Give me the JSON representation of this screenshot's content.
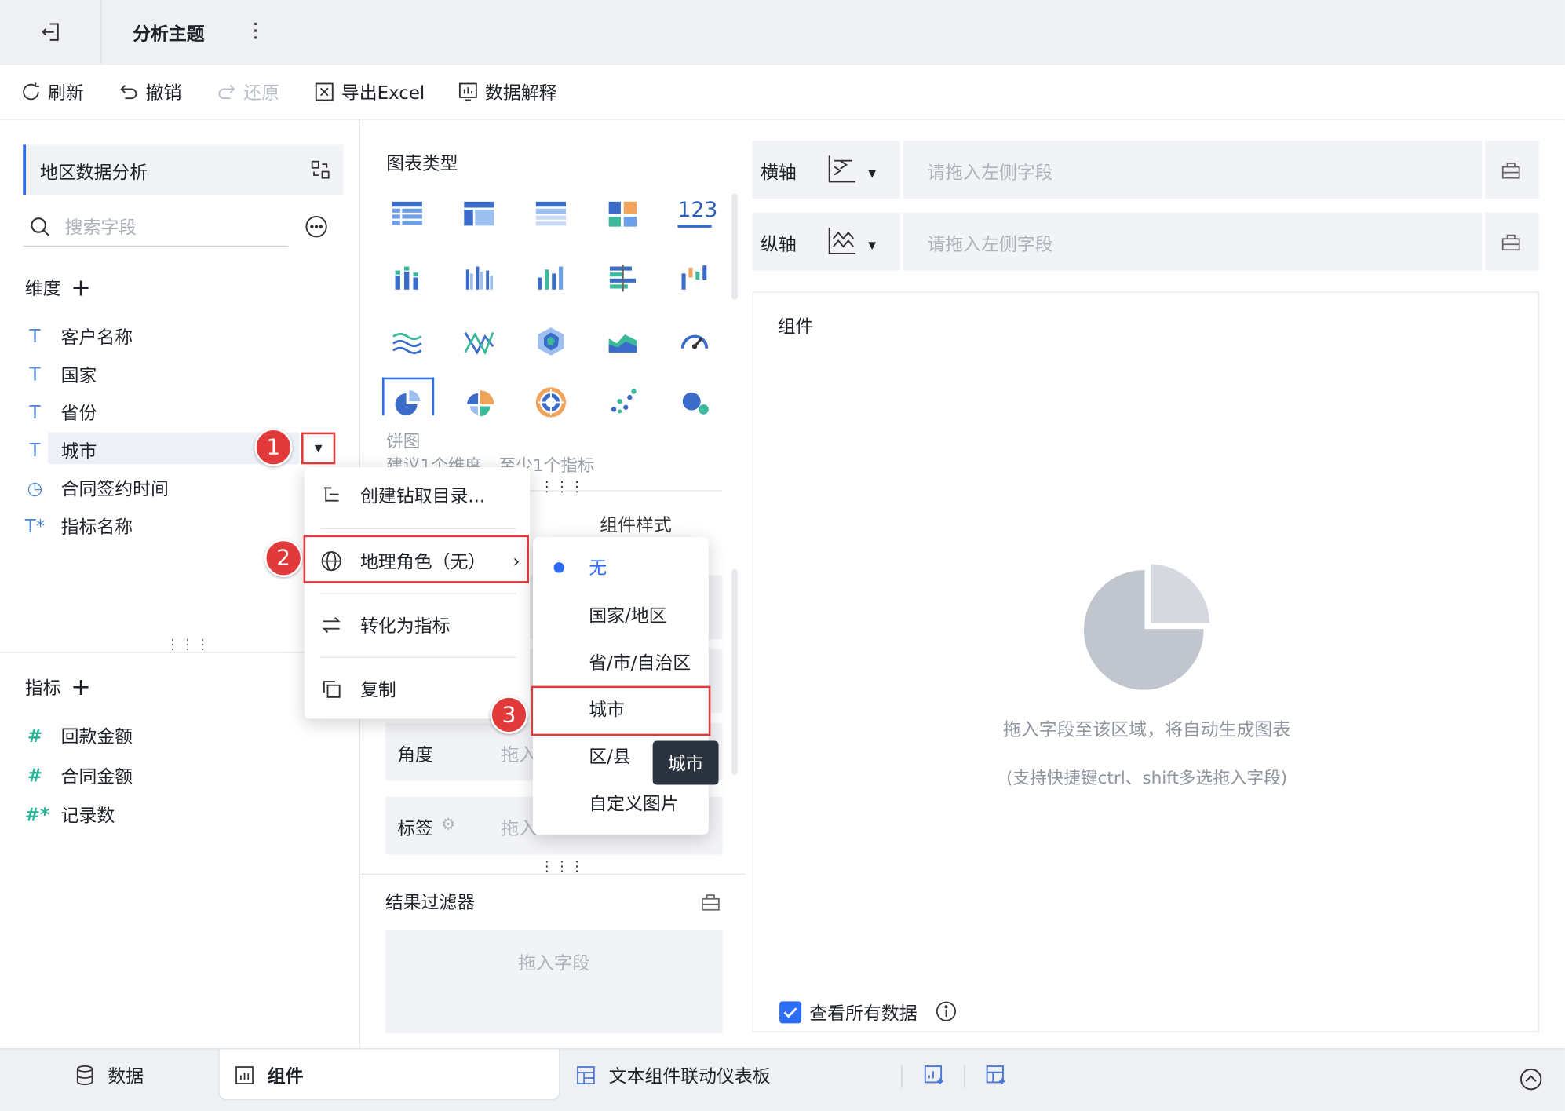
{
  "topbar": {
    "title": "分析主题",
    "more": "⋮"
  },
  "toolbar": {
    "refresh": "刷新",
    "undo": "撤销",
    "redo": "还原",
    "export": "导出Excel",
    "explain": "数据解释"
  },
  "left": {
    "dataset": "地区数据分析",
    "search_placeholder": "搜索字段",
    "dimensions_title": "维度",
    "dimensions": [
      {
        "icon": "T",
        "label": "客户名称"
      },
      {
        "icon": "T",
        "label": "国家"
      },
      {
        "icon": "T",
        "label": "省份"
      },
      {
        "icon": "T",
        "label": "城市"
      },
      {
        "icon": "◷",
        "label": "合同签约时间"
      },
      {
        "icon": "T*",
        "label": "指标名称"
      }
    ],
    "measures_title": "指标",
    "measures": [
      {
        "icon": "#",
        "label": "回款金额"
      },
      {
        "icon": "#",
        "label": "合同金额"
      },
      {
        "icon": "#*",
        "label": "记录数"
      }
    ],
    "grip": "⋮⋮⋮"
  },
  "middle": {
    "chart_type_title": "图表类型",
    "number_icon": "123",
    "chart_caption": "饼图",
    "chart_tip": "建议1个维度，至少1个指标",
    "style_tab": "组件样式",
    "angle_label": "角度",
    "label_label": "标签",
    "drop_placeholder": "拖入",
    "filter_title": "结果过滤器",
    "filter_placeholder": "拖入字段"
  },
  "right": {
    "x_axis": "横轴",
    "y_axis": "纵轴",
    "axis_placeholder": "请拖入左侧字段",
    "canvas_title": "组件",
    "empty_hint": "拖入字段至该区域，将自动生成图表",
    "empty_sub": "(支持快捷键ctrl、shift多选拖入字段)",
    "view_all": "查看所有数据"
  },
  "bottom": {
    "data_tab": "数据",
    "component_tab": "组件",
    "dashboard_tab": "文本组件联动仪表板"
  },
  "context_menu": {
    "items": [
      "创建钻取目录...",
      "地理角色（无）",
      "转化为指标",
      "复制"
    ]
  },
  "submenu": {
    "items": [
      "无",
      "国家/地区",
      "省/市/自治区",
      "城市",
      "区/县",
      "自定义图片"
    ],
    "selected": "无"
  },
  "tooltip": "城市",
  "badges": [
    "1",
    "2",
    "3"
  ],
  "colors": {
    "accent": "#2d6cf6",
    "highlight": "#e23a3a",
    "chart_blue": "#4a78d6",
    "chart_teal": "#3cb89b",
    "chart_orange": "#f0a35b"
  }
}
